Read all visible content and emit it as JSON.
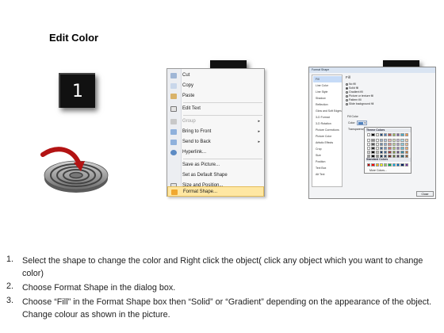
{
  "title": "Edit Color",
  "steps": [
    "1",
    "2",
    "3"
  ],
  "menu": {
    "items": [
      {
        "label": "Cut",
        "disabled": false,
        "submenu": false
      },
      {
        "label": "Copy",
        "disabled": false,
        "submenu": false
      },
      {
        "label": "Paste",
        "disabled": false,
        "submenu": false
      },
      {
        "label": "Edit Text",
        "disabled": false,
        "submenu": false
      },
      {
        "label": "Group",
        "disabled": true,
        "submenu": true
      },
      {
        "label": "Bring to Front",
        "disabled": false,
        "submenu": true
      },
      {
        "label": "Send to Back",
        "disabled": false,
        "submenu": true
      },
      {
        "label": "Hyperlink...",
        "disabled": false,
        "submenu": false
      },
      {
        "label": "Save as Picture...",
        "disabled": false,
        "submenu": false
      },
      {
        "label": "Set as Default Shape",
        "disabled": false,
        "submenu": false
      },
      {
        "label": "Size and Position...",
        "disabled": false,
        "submenu": false
      },
      {
        "label": "Format Shape...",
        "disabled": false,
        "submenu": false,
        "highlighted": true
      }
    ]
  },
  "dialog": {
    "title": "Format Shape",
    "categories": [
      "Fill",
      "Line Color",
      "Line Style",
      "Shadow",
      "Reflection",
      "Glow and Soft Edges",
      "3-D Format",
      "3-D Rotation",
      "Picture Corrections",
      "Picture Color",
      "Artistic Effects",
      "Crop",
      "Size",
      "Position",
      "Text Box",
      "Alt Text"
    ],
    "selected_category": "Fill",
    "fill_heading": "Fill",
    "fill_options": [
      "No fill",
      "Solid fill",
      "Gradient fill",
      "Picture or texture fill",
      "Pattern fill",
      "Slide background fill"
    ],
    "fill_color_label": "Fill Color",
    "color_label": "Color:",
    "transparency_label": "Transparency:",
    "palette": {
      "theme_header": "Theme Colors",
      "standard_header": "Standard Colors",
      "more_colors": "More Colors...",
      "theme_colors": [
        "#ffffff",
        "#000000",
        "#eeece1",
        "#1f497d",
        "#4f81bd",
        "#c0504d",
        "#9bbb59",
        "#8064a2",
        "#4bacc6",
        "#f79646"
      ],
      "standard_colors": [
        "#c00000",
        "#ff0000",
        "#ffc000",
        "#ffff00",
        "#92d050",
        "#00b050",
        "#00b0f0",
        "#0070c0",
        "#002060",
        "#7030a0"
      ]
    },
    "close_label": "Close"
  },
  "instructions": [
    {
      "num": "1.",
      "text": "Select the shape to change the color and Right click the object( click any object which you want to change color)"
    },
    {
      "num": "2.",
      "text": "Choose Format Shape in the dialog box."
    },
    {
      "num": "3.",
      "text": "Choose “Fill” in the Format Shape box then “Solid” or “Gradient” depending on the appearance of the object. Change colour as shown in the picture."
    }
  ]
}
